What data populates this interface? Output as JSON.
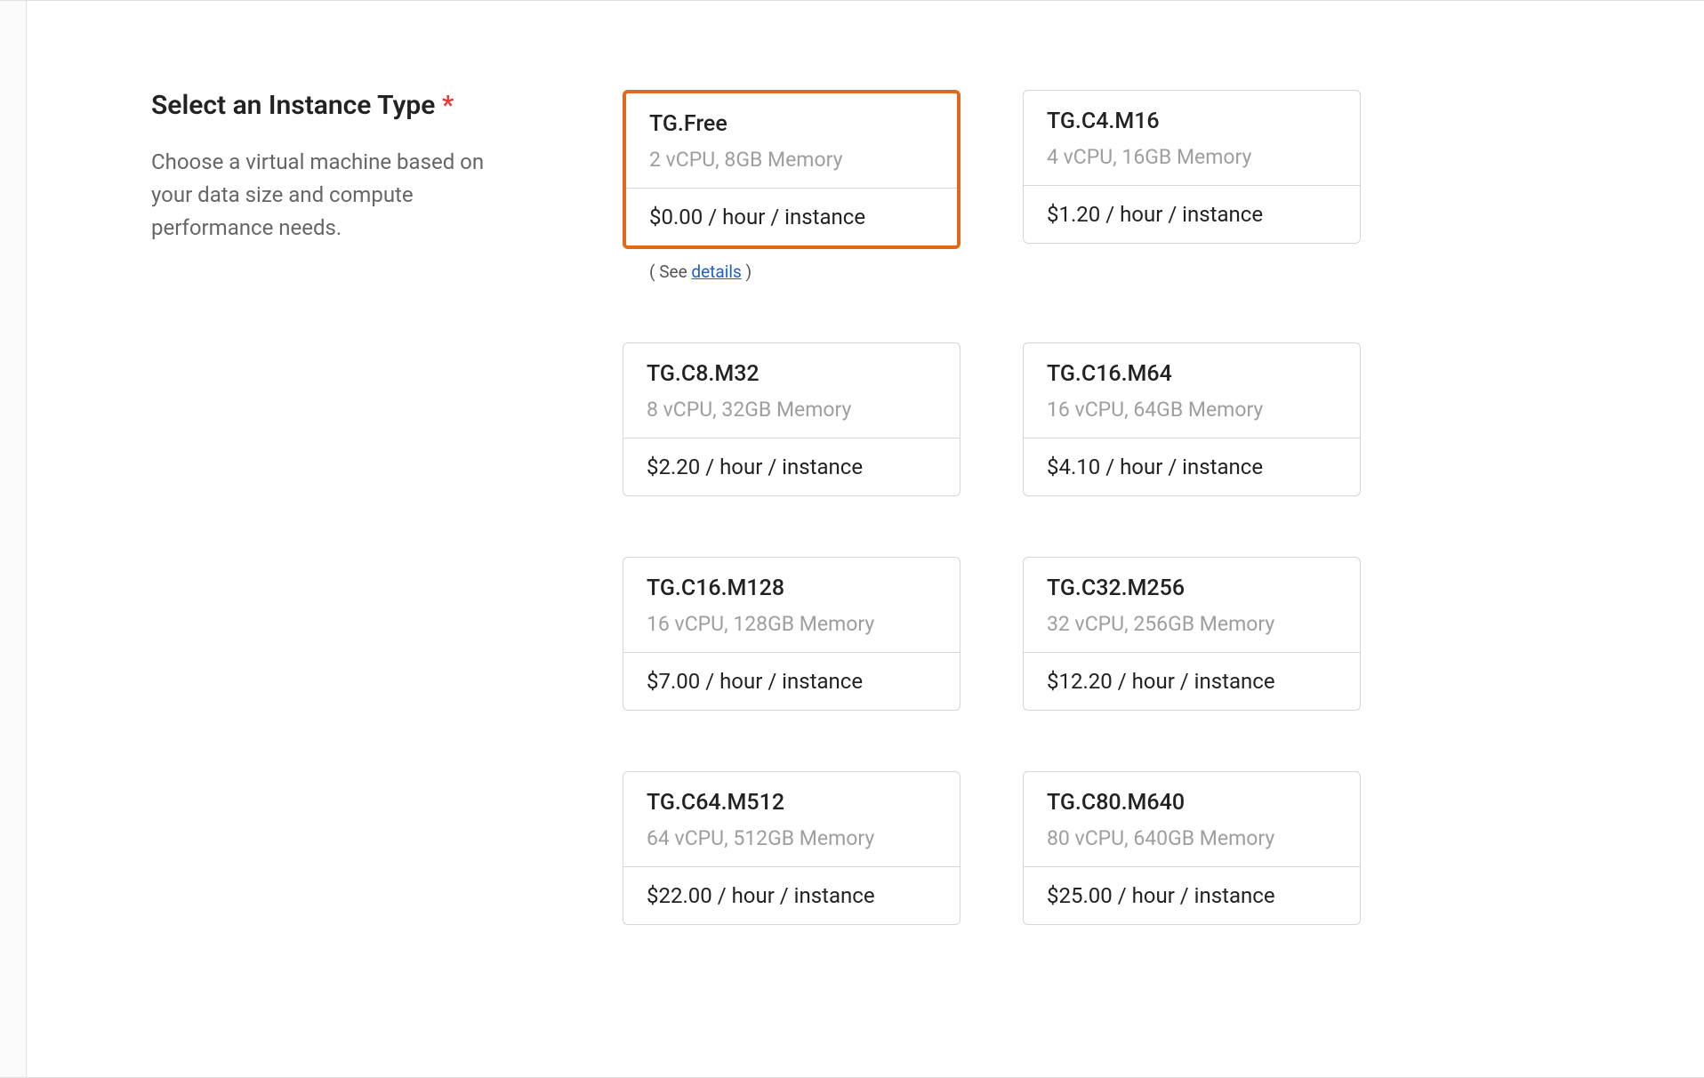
{
  "section": {
    "title": "Select an Instance Type",
    "required_mark": "*",
    "description": "Choose a virtual machine based on your data size and compute performance needs."
  },
  "details": {
    "prefix": "( See ",
    "link": "details",
    "suffix": " )"
  },
  "instances": [
    {
      "name": "TG.Free",
      "spec": "2 vCPU, 8GB Memory",
      "price": "$0.00 / hour / instance",
      "selected": true,
      "show_details": true
    },
    {
      "name": "TG.C4.M16",
      "spec": "4 vCPU, 16GB Memory",
      "price": "$1.20 / hour / instance",
      "selected": false,
      "show_details": false
    },
    {
      "name": "TG.C8.M32",
      "spec": "8 vCPU, 32GB Memory",
      "price": "$2.20 / hour / instance",
      "selected": false,
      "show_details": false
    },
    {
      "name": "TG.C16.M64",
      "spec": "16 vCPU, 64GB Memory",
      "price": "$4.10 / hour / instance",
      "selected": false,
      "show_details": false
    },
    {
      "name": "TG.C16.M128",
      "spec": "16 vCPU, 128GB Memory",
      "price": "$7.00 / hour / instance",
      "selected": false,
      "show_details": false
    },
    {
      "name": "TG.C32.M256",
      "spec": "32 vCPU, 256GB Memory",
      "price": "$12.20 / hour / instance",
      "selected": false,
      "show_details": false
    },
    {
      "name": "TG.C64.M512",
      "spec": "64 vCPU, 512GB Memory",
      "price": "$22.00 / hour / instance",
      "selected": false,
      "show_details": false
    },
    {
      "name": "TG.C80.M640",
      "spec": "80 vCPU, 640GB Memory",
      "price": "$25.00 / hour / instance",
      "selected": false,
      "show_details": false
    }
  ]
}
